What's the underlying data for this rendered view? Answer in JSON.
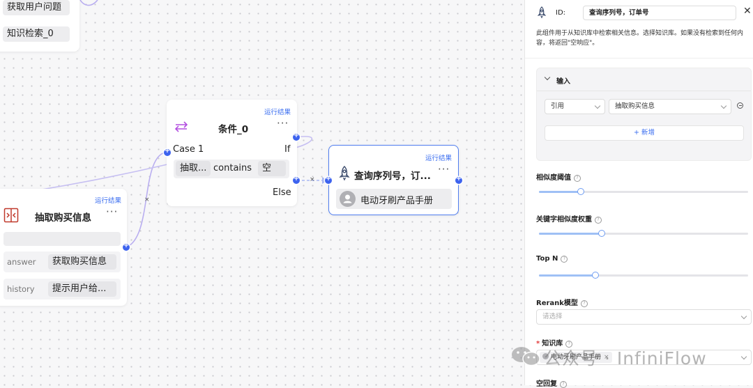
{
  "canvas": {
    "top_node": {
      "items": [
        "获取用户问题",
        "知识检索_0"
      ]
    },
    "extract_node": {
      "title": "抽取购买信息",
      "run_result": "运行结果",
      "fields": [
        {
          "key": "answer",
          "value": "获取购买信息"
        },
        {
          "key": "history",
          "value": "提示用户给..."
        }
      ]
    },
    "condition_node": {
      "title": "条件_0",
      "run_result": "运行结果",
      "case_label": "Case 1",
      "if_label": "If",
      "cond_var": "抽取...",
      "cond_op": "contains",
      "cond_val": "空",
      "else_label": "Else"
    },
    "query_node": {
      "title": "查询序列号，订...",
      "run_result": "运行结果",
      "kb_item": "电动牙刷产品手册"
    },
    "edge_marks": [
      "×",
      "×"
    ]
  },
  "panel": {
    "id_label": "ID:",
    "id_value": "查询序列号，订单号",
    "description": "此组件用于从知识库中检索相关信息。选择知识库。如果没有检索到任何内容，将返回\"空响应\"。",
    "input_section": {
      "title": "输入",
      "ref_type": "引用",
      "ref_value": "抽取购买信息",
      "add_label": "+ 新增"
    },
    "similarity_label": "相似度阈值",
    "similarity_value": 0.2,
    "keyword_weight_label": "关键字相似度权重",
    "keyword_weight_value": 0.3,
    "topn_label": "Top N",
    "topn_value": 0.27,
    "rerank_label": "Rerank模型",
    "rerank_placeholder": "请选择",
    "kb_label": "知识库",
    "kb_required": "*",
    "kb_tag": "电动牙刷产品手册",
    "empty_reply_label": "空回复"
  },
  "watermark": "公众号 · InfiniFlow"
}
